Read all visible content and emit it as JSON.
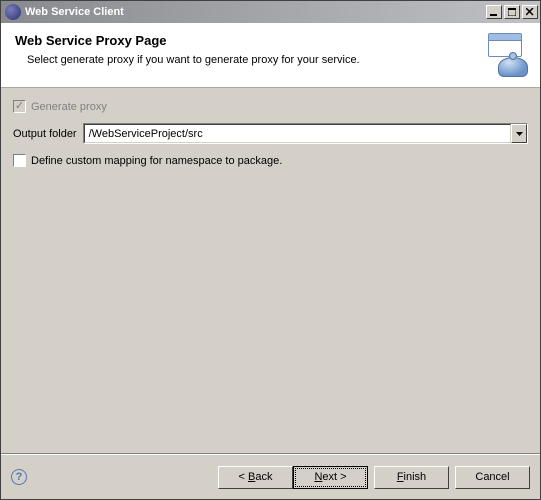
{
  "titlebar": {
    "text": "Web Service Client"
  },
  "header": {
    "title": "Web Service Proxy Page",
    "description": "Select generate proxy if you want to generate proxy for your service."
  },
  "form": {
    "generate_proxy": {
      "label": "Generate proxy",
      "checked": true,
      "enabled": false
    },
    "output_folder": {
      "label": "Output folder",
      "value": "/WebServiceProject/src"
    },
    "custom_mapping": {
      "label": "Define custom mapping for namespace to package.",
      "checked": false,
      "enabled": true
    }
  },
  "buttons": {
    "back": {
      "prefix": "< ",
      "letter": "B",
      "suffix": "ack"
    },
    "next": {
      "letter": "N",
      "suffix": "ext >"
    },
    "finish": {
      "letter": "F",
      "suffix": "inish"
    },
    "cancel": {
      "text": "Cancel"
    }
  }
}
